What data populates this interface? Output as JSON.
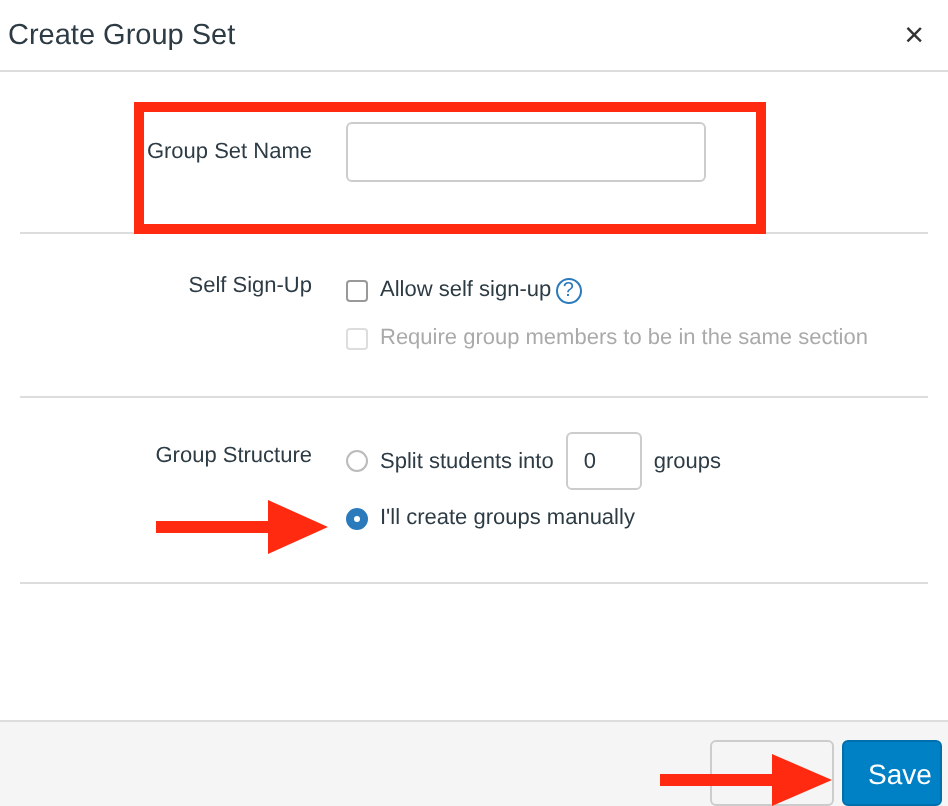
{
  "dialog": {
    "title": "Create Group Set",
    "close": "×"
  },
  "name_field": {
    "label": "Group Set Name"
  },
  "self_signup": {
    "label": "Self Sign-Up",
    "options": [
      {
        "label": "Allow self sign-up",
        "checked": false,
        "disabled": false,
        "help": "?"
      },
      {
        "label": "Require group members to be in the same section",
        "checked": false,
        "disabled": true
      }
    ]
  },
  "group_structure": {
    "label": "Group Structure",
    "options": [
      {
        "kind": "split",
        "label_before": "Split students into",
        "value": "0",
        "label_after": "groups",
        "selected": false
      },
      {
        "kind": "plain",
        "label": "I'll create groups manually",
        "selected": true
      }
    ]
  },
  "buttons": [
    {
      "kind": "secondary"
    },
    {
      "kind": "primary",
      "label": "Save"
    }
  ],
  "annotations": [
    {
      "kind": "box"
    },
    {
      "kind": "arrow"
    },
    {
      "kind": "arrow"
    }
  ]
}
